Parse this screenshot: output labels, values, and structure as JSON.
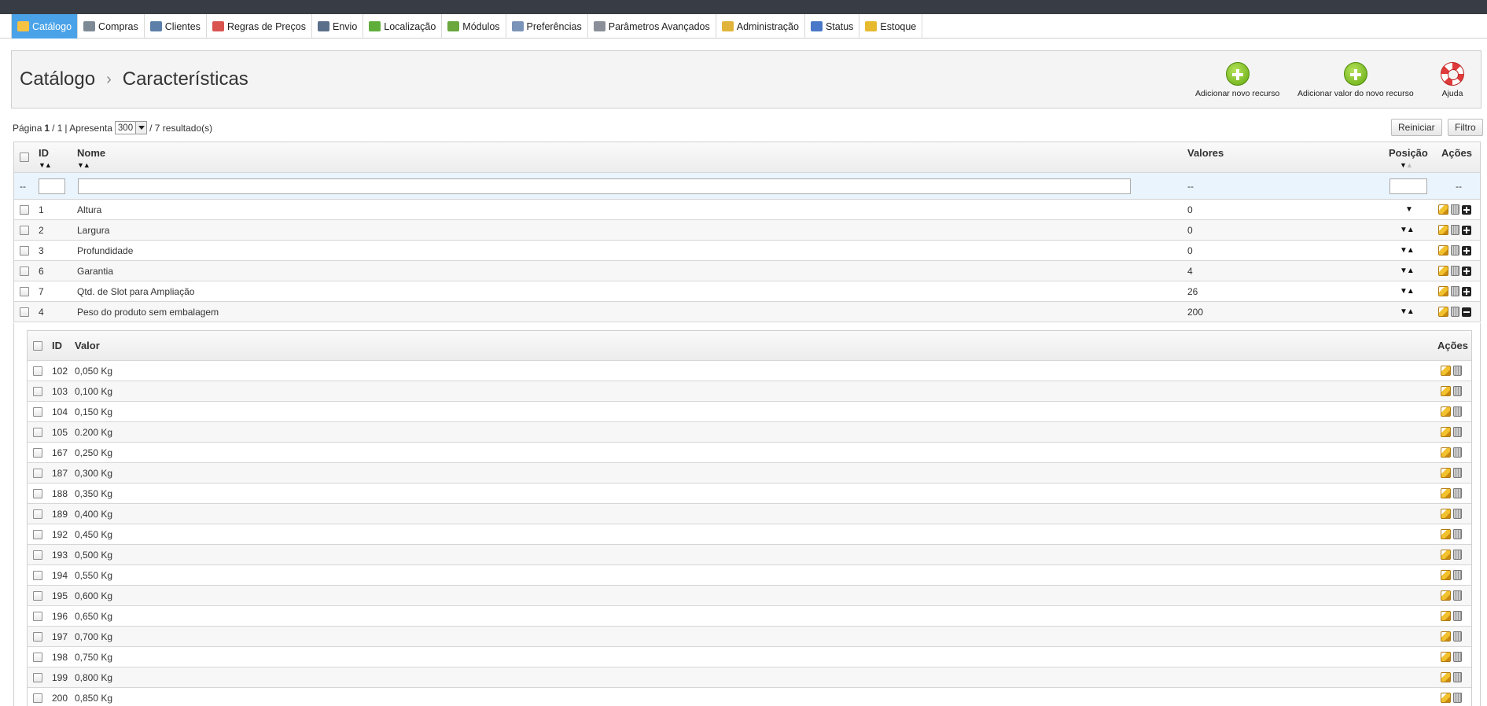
{
  "tabs": [
    {
      "label": "Catálogo",
      "icon": "folder-icon",
      "color": "#f5c242",
      "active": true
    },
    {
      "label": "Compras",
      "icon": "cart-icon",
      "color": "#7d8a96"
    },
    {
      "label": "Clientes",
      "icon": "user-icon",
      "color": "#5b7fa8"
    },
    {
      "label": "Regras de Preços",
      "icon": "price-rules-icon",
      "color": "#d9534f"
    },
    {
      "label": "Envio",
      "icon": "truck-icon",
      "color": "#5a6f8a"
    },
    {
      "label": "Localização",
      "icon": "globe-icon",
      "color": "#5fae3a"
    },
    {
      "label": "Módulos",
      "icon": "puzzle-icon",
      "color": "#6aa83e"
    },
    {
      "label": "Preferências",
      "icon": "preferences-icon",
      "color": "#7a93b8"
    },
    {
      "label": "Parâmetros Avançados",
      "icon": "wrench-icon",
      "color": "#8a8f99"
    },
    {
      "label": "Administração",
      "icon": "key-icon",
      "color": "#e0b43a"
    },
    {
      "label": "Status",
      "icon": "bar-chart-icon",
      "color": "#4a78c8"
    },
    {
      "label": "Estoque",
      "icon": "stock-icon",
      "color": "#e7b92e"
    }
  ],
  "breadcrumb": {
    "parent": "Catálogo",
    "separator": "›",
    "current": "Características"
  },
  "toolbar": {
    "add_feature": "Adicionar novo recurso",
    "add_feature_value": "Adicionar valor do novo recurso",
    "help": "Ajuda"
  },
  "pager": {
    "page_label": "Página",
    "page": "1",
    "page_total": "/ 1",
    "show_label": "| Apresenta",
    "per_page": "300",
    "results": "/ 7 resultado(s)"
  },
  "buttons": {
    "reset": "Reiniciar",
    "filter": "Filtro"
  },
  "grid": {
    "headers": {
      "id": "ID",
      "name": "Nome",
      "values": "Valores",
      "position": "Posição",
      "actions": "Ações"
    },
    "filter_placeholder": "--",
    "rows": [
      {
        "id": "1",
        "name": "Altura",
        "values": "0",
        "arrows": "▼"
      },
      {
        "id": "2",
        "name": "Largura",
        "values": "0",
        "arrows": "▼▲"
      },
      {
        "id": "3",
        "name": "Profundidade",
        "values": "0",
        "arrows": "▼▲"
      },
      {
        "id": "6",
        "name": "Garantia",
        "values": "4",
        "arrows": "▼▲"
      },
      {
        "id": "7",
        "name": "Qtd. de Slot para Ampliação",
        "values": "26",
        "arrows": "▼▲"
      },
      {
        "id": "4",
        "name": "Peso do produto sem embalagem",
        "values": "200",
        "arrows": "▼▲",
        "expanded": true
      }
    ]
  },
  "subgrid": {
    "headers": {
      "id": "ID",
      "value": "Valor",
      "actions": "Ações"
    },
    "rows": [
      {
        "id": "102",
        "value": "0,050 Kg"
      },
      {
        "id": "103",
        "value": "0,100 Kg"
      },
      {
        "id": "104",
        "value": "0,150 Kg"
      },
      {
        "id": "105",
        "value": "0.200 Kg"
      },
      {
        "id": "167",
        "value": "0,250 Kg"
      },
      {
        "id": "187",
        "value": "0,300 Kg"
      },
      {
        "id": "188",
        "value": "0,350 Kg"
      },
      {
        "id": "189",
        "value": "0,400 Kg"
      },
      {
        "id": "192",
        "value": "0,450 Kg"
      },
      {
        "id": "193",
        "value": "0,500 Kg"
      },
      {
        "id": "194",
        "value": "0,550 Kg"
      },
      {
        "id": "195",
        "value": "0,600 Kg"
      },
      {
        "id": "196",
        "value": "0,650 Kg"
      },
      {
        "id": "197",
        "value": "0,700 Kg"
      },
      {
        "id": "198",
        "value": "0,750 Kg"
      },
      {
        "id": "199",
        "value": "0,800 Kg"
      },
      {
        "id": "200",
        "value": "0,850 Kg"
      }
    ]
  }
}
